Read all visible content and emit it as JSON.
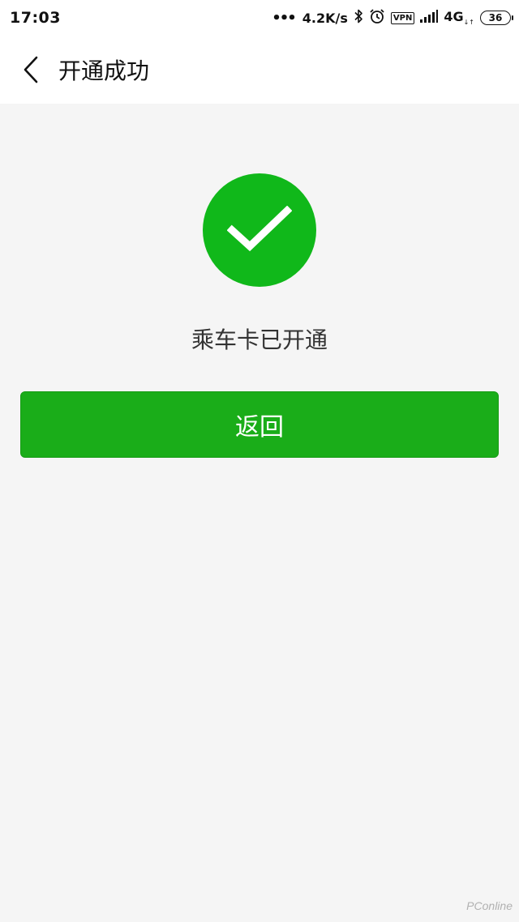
{
  "status_bar": {
    "time": "17:03",
    "net_speed": "4.2K/s",
    "vpn": "VPN",
    "network": "4G",
    "battery": "36",
    "icons": [
      "more-dots-icon",
      "bluetooth-icon",
      "alarm-icon",
      "signal-icon"
    ]
  },
  "nav": {
    "title": "开通成功",
    "back_icon": "chevron-left-icon"
  },
  "result": {
    "icon": "check-circle-icon",
    "icon_color": "#10b81a",
    "message": "乘车卡已开通"
  },
  "actions": {
    "return_label": "返回",
    "button_color": "#1aad19"
  },
  "watermark": "PConline"
}
